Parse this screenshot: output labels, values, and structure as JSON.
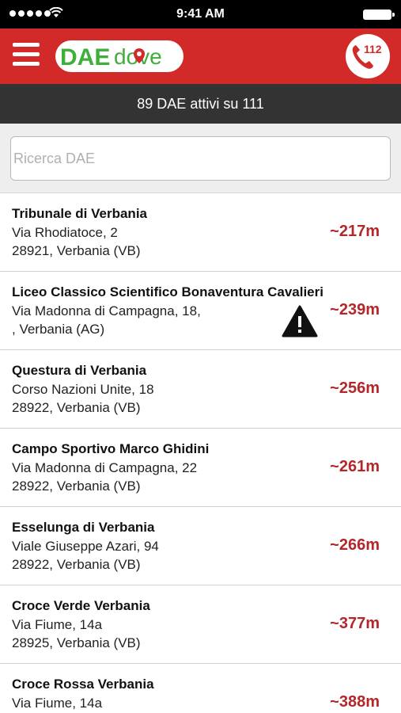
{
  "status_bar": {
    "time": "9:41 AM"
  },
  "header": {
    "logo_text_dae": "DAE",
    "logo_text_dove": "dove",
    "emergency_number": "112"
  },
  "count_bar": {
    "text": "89 DAE attivi su 111"
  },
  "search": {
    "placeholder": "Ricerca DAE"
  },
  "colors": {
    "brand_red": "#d22a28",
    "logo_green": "#3fae3a",
    "distance_red": "#b3262a"
  },
  "locations": [
    {
      "name": "Tribunale di Verbania",
      "address": "Via Rhodiatoce, 2",
      "city": "28921, Verbania (VB)",
      "distance": "~217m"
    },
    {
      "name": "Liceo Classico Scientifico Bonaventura Cavalieri",
      "address": "Via Madonna di Campagna, 18,",
      "city": ", Verbania (AG)",
      "distance": "~239m",
      "icon": "warning-icon"
    },
    {
      "name": "Questura di Verbania",
      "address": "Corso Nazioni Unite, 18",
      "city": "28922, Verbania (VB)",
      "distance": "~256m"
    },
    {
      "name": "Campo Sportivo Marco Ghidini",
      "address": "Via Madonna di Campagna, 22",
      "city": "28922, Verbania (VB)",
      "distance": "~261m"
    },
    {
      "name": "Esselunga di Verbania",
      "address": "Viale Giuseppe Azari, 94",
      "city": "28922, Verbania (VB)",
      "distance": "~266m"
    },
    {
      "name": "Croce Verde Verbania",
      "address": "Via Fiume, 14a",
      "city": "28925, Verbania (VB)",
      "distance": "~377m"
    },
    {
      "name": "Croce Rossa Verbania",
      "address": "Via Fiume, 14a",
      "city": "",
      "distance": "~388m"
    }
  ]
}
